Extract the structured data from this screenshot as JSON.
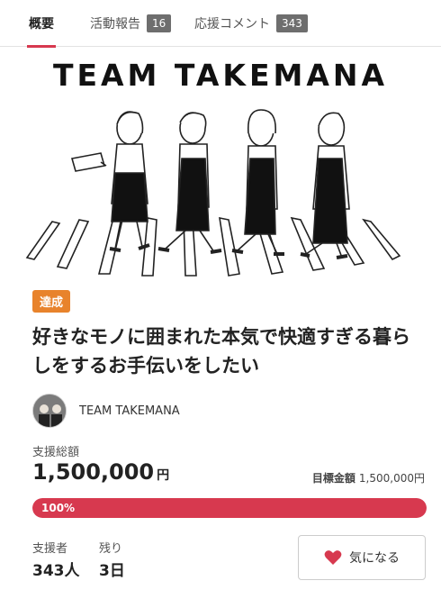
{
  "tabs": [
    {
      "label": "概要",
      "badge": null,
      "active": true
    },
    {
      "label": "活動報告",
      "badge": "16",
      "active": false
    },
    {
      "label": "応援コメント",
      "badge": "343",
      "active": false
    }
  ],
  "hero": {
    "title": "TEAM TAKEMANA"
  },
  "status_badge": "達成",
  "project_title": "好きなモノに囲まれた本気で快適すぎる暮らしをするお手伝いをしたい",
  "owner": {
    "name": "TEAM TAKEMANA"
  },
  "funding": {
    "total_label": "支援総額",
    "total_amount": "1,500,000",
    "currency_unit": "円",
    "goal_label": "目標金額",
    "goal_amount": "1,500,000円",
    "progress_text": "100%",
    "progress_fraction": 1.0
  },
  "stats": {
    "supporters_label": "支援者",
    "supporters_value": "343人",
    "remaining_label": "残り",
    "remaining_value": "3日"
  },
  "favorite_button": {
    "label": "気になる"
  },
  "colors": {
    "accent": "#d7394f",
    "achieved": "#e8832c",
    "badge_gray": "#6e6e6e"
  }
}
